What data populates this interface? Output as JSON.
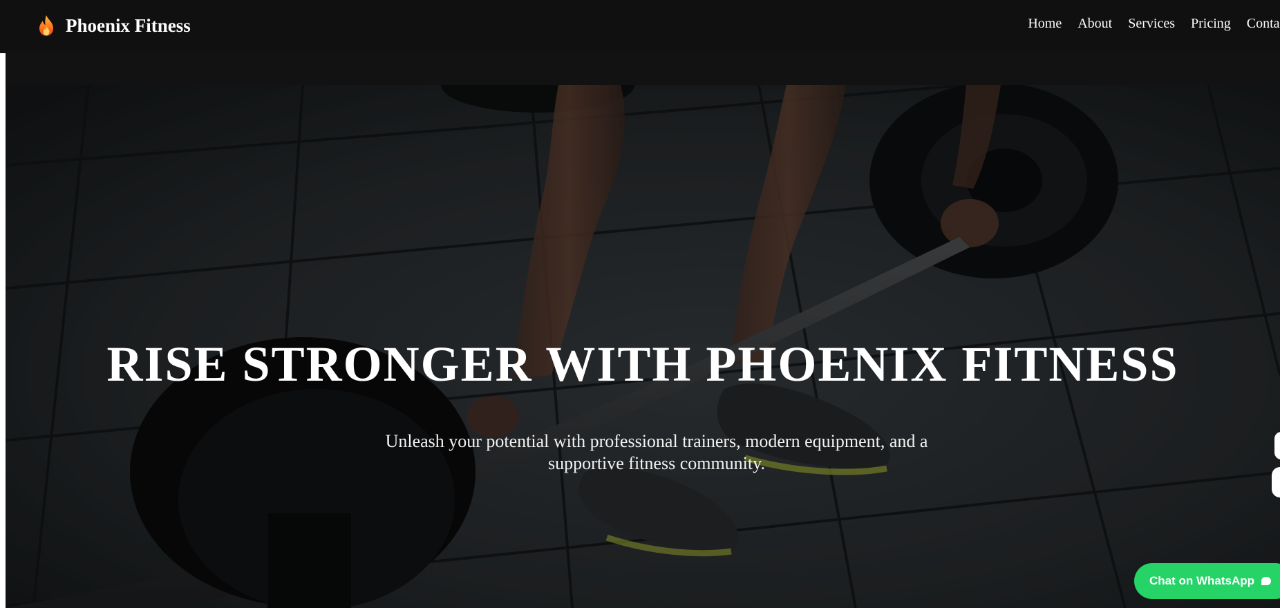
{
  "brand": {
    "icon": "flame-icon",
    "name": "Phoenix Fitness"
  },
  "nav": {
    "items": [
      {
        "label": "Home"
      },
      {
        "label": "About"
      },
      {
        "label": "Services"
      },
      {
        "label": "Pricing"
      },
      {
        "label": "Contact"
      }
    ]
  },
  "hero": {
    "title": "RISE STRONGER WITH PHOENIX FITNESS",
    "subtitle": "Unleash your potential with professional trainers, modern equipment, and a supportive fitness community.",
    "background_image": "gym-deadlift-photo"
  },
  "whatsapp": {
    "label": "Chat on WhatsApp",
    "icon": "chat-bubble-icon",
    "color": "#25d366"
  },
  "colors": {
    "navbar": "#101010",
    "text": "#ffffff"
  }
}
